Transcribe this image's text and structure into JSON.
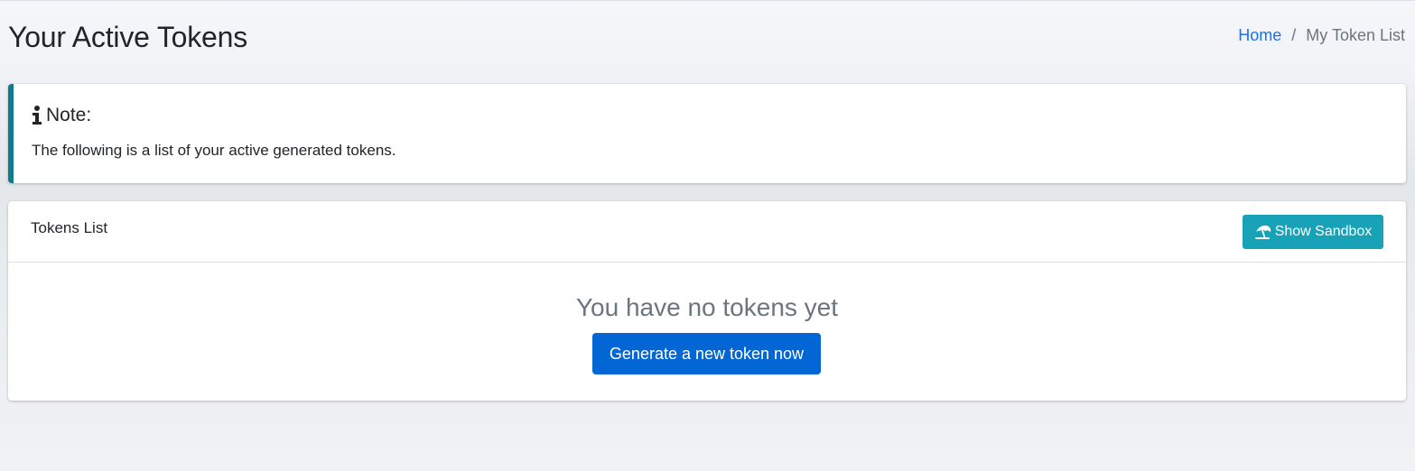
{
  "header": {
    "title": "Your Active Tokens",
    "breadcrumb": {
      "home": "Home",
      "separator": "/",
      "current": "My Token List"
    }
  },
  "note": {
    "icon": "info-icon",
    "title": "Note:",
    "text": "The following is a list of your active generated tokens.",
    "accent_color": "#117a8b"
  },
  "tokens_card": {
    "title": "Tokens List",
    "sandbox_button": {
      "icon": "umbrella-beach-icon",
      "label": "Show Sandbox",
      "color": "#17a2b8"
    },
    "empty_message": "You have no tokens yet",
    "generate_button": {
      "label": "Generate a new token now",
      "color": "#0267d4"
    }
  }
}
